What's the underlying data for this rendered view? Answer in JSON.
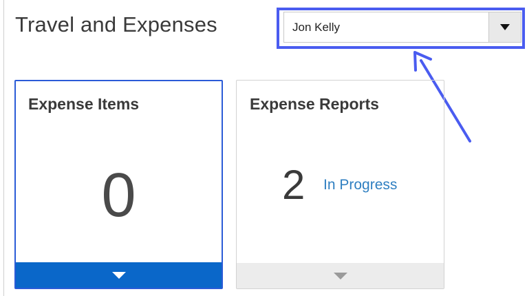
{
  "header": {
    "title": "Travel and Expenses",
    "person_select": {
      "value": "Jon Kelly",
      "icon": "caret-down-icon"
    }
  },
  "annotation": {
    "color": "#4a5cf0"
  },
  "tiles": [
    {
      "title": "Expense Items",
      "count": "0",
      "status": "",
      "footer_icon": "caret-down-icon",
      "accent": "#0a67c9"
    },
    {
      "title": "Expense Reports",
      "count": "2",
      "status": "In Progress",
      "footer_icon": "caret-down-icon",
      "accent": "#ececec"
    }
  ]
}
